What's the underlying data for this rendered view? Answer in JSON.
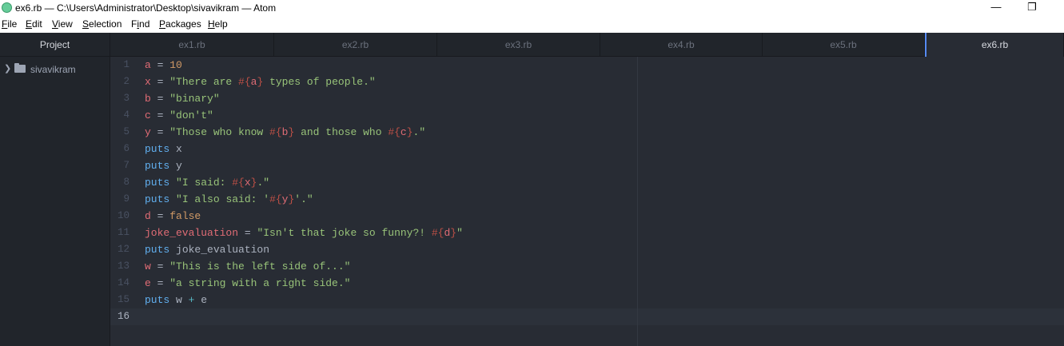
{
  "window": {
    "title": "ex6.rb — C:\\Users\\Administrator\\Desktop\\sivavikram — Atom",
    "minimize_glyph": "—",
    "restore_glyph": "❐"
  },
  "menu": [
    {
      "label": "File",
      "key": "F",
      "rest": "ile"
    },
    {
      "label": "Edit",
      "key": "E",
      "rest": "dit"
    },
    {
      "label": "View",
      "key": "V",
      "rest": "iew"
    },
    {
      "label": "Selection",
      "key": "S",
      "rest": "election"
    },
    {
      "label": "Find",
      "key": "",
      "pre": "F",
      "under": "i",
      "post": "nd"
    },
    {
      "label": "Packages",
      "key": "P",
      "rest": "ackages"
    },
    {
      "label": "Help",
      "key": "H",
      "rest": "elp"
    }
  ],
  "sidebar": {
    "title": "Project",
    "folder": "sivavikram"
  },
  "tabs": [
    "ex1.rb",
    "ex2.rb",
    "ex3.rb",
    "ex4.rb",
    "ex5.rb",
    "ex6.rb"
  ],
  "active_tab": "ex6.rb",
  "editor": {
    "line_numbers": [
      "1",
      "2",
      "3",
      "4",
      "5",
      "6",
      "7",
      "8",
      "9",
      "10",
      "11",
      "12",
      "13",
      "14",
      "15",
      "16"
    ],
    "current_line": 16,
    "lines": [
      [
        [
          "var",
          "a"
        ],
        [
          "pl",
          " = "
        ],
        [
          "num",
          "10"
        ]
      ],
      [
        [
          "var",
          "x"
        ],
        [
          "pl",
          " = "
        ],
        [
          "str",
          "\"There are "
        ],
        [
          "interp",
          "#{"
        ],
        [
          "var",
          "a"
        ],
        [
          "interp",
          "}"
        ],
        [
          "str",
          " types of people.\""
        ]
      ],
      [
        [
          "var",
          "b"
        ],
        [
          "pl",
          " = "
        ],
        [
          "str",
          "\"binary\""
        ]
      ],
      [
        [
          "var",
          "c"
        ],
        [
          "pl",
          " = "
        ],
        [
          "str",
          "\"don't\""
        ]
      ],
      [
        [
          "var",
          "y"
        ],
        [
          "pl",
          " = "
        ],
        [
          "str",
          "\"Those who know "
        ],
        [
          "interp",
          "#{"
        ],
        [
          "var",
          "b"
        ],
        [
          "interp",
          "}"
        ],
        [
          "str",
          " and those who "
        ],
        [
          "interp",
          "#{"
        ],
        [
          "var",
          "c"
        ],
        [
          "interp",
          "}"
        ],
        [
          "str",
          ".\""
        ]
      ],
      [
        [
          "kw",
          "puts"
        ],
        [
          "pl",
          " x"
        ]
      ],
      [
        [
          "kw",
          "puts"
        ],
        [
          "pl",
          " y"
        ]
      ],
      [
        [
          "kw",
          "puts"
        ],
        [
          "pl",
          " "
        ],
        [
          "str",
          "\"I said: "
        ],
        [
          "interp",
          "#{"
        ],
        [
          "var",
          "x"
        ],
        [
          "interp",
          "}"
        ],
        [
          "str",
          ".\""
        ]
      ],
      [
        [
          "kw",
          "puts"
        ],
        [
          "pl",
          " "
        ],
        [
          "str",
          "\"I also said: '"
        ],
        [
          "interp",
          "#{"
        ],
        [
          "var",
          "y"
        ],
        [
          "interp",
          "}"
        ],
        [
          "str",
          "'.\""
        ]
      ],
      [
        [
          "var",
          "d"
        ],
        [
          "pl",
          " = "
        ],
        [
          "num",
          "false"
        ]
      ],
      [
        [
          "var",
          "joke_evaluation"
        ],
        [
          "pl",
          " = "
        ],
        [
          "str",
          "\"Isn't that joke so funny?! "
        ],
        [
          "interp",
          "#{"
        ],
        [
          "var",
          "d"
        ],
        [
          "interp",
          "}"
        ],
        [
          "str",
          "\""
        ]
      ],
      [
        [
          "kw",
          "puts"
        ],
        [
          "pl",
          " joke_evaluation"
        ]
      ],
      [
        [
          "var",
          "w"
        ],
        [
          "pl",
          " = "
        ],
        [
          "str",
          "\"This is the left side of...\""
        ]
      ],
      [
        [
          "var",
          "e"
        ],
        [
          "pl",
          " = "
        ],
        [
          "str",
          "\"a string with a right side.\""
        ]
      ],
      [
        [
          "kw",
          "puts"
        ],
        [
          "pl",
          " w "
        ],
        [
          "op",
          "+"
        ],
        [
          "pl",
          " e"
        ]
      ],
      []
    ]
  }
}
